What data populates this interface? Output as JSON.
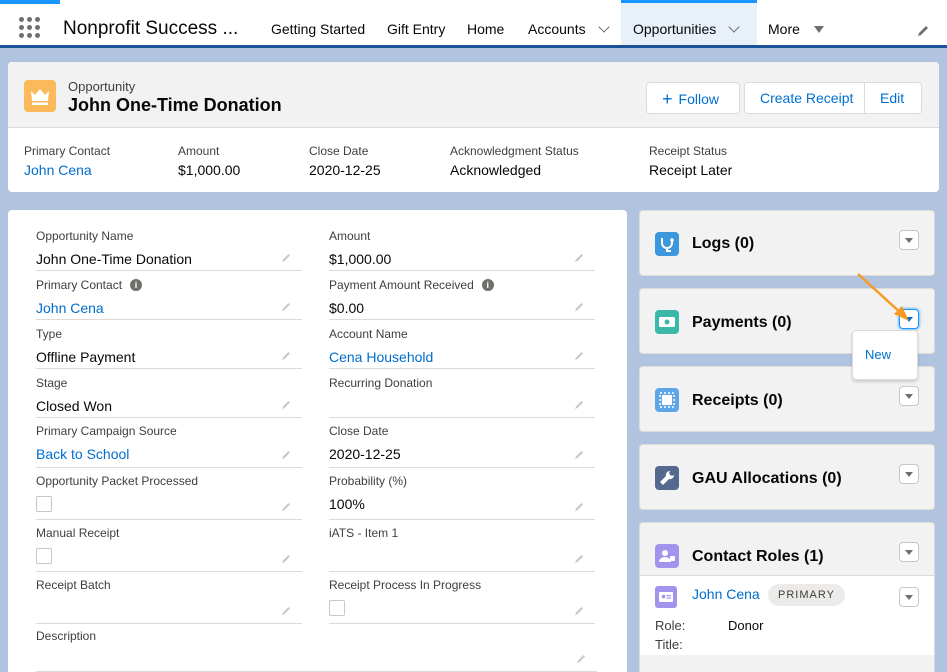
{
  "nav": {
    "app_name": "Nonprofit Success ...",
    "tabs": [
      {
        "label": "Getting Started"
      },
      {
        "label": "Gift Entry"
      },
      {
        "label": "Home"
      },
      {
        "label": "Accounts"
      },
      {
        "label": "Opportunities"
      },
      {
        "label": "More"
      }
    ]
  },
  "header": {
    "object_label": "Opportunity",
    "record_name": "John One-Time Donation",
    "buttons": {
      "follow": "Follow",
      "create_receipt": "Create Receipt",
      "edit": "Edit"
    },
    "fields": [
      {
        "label": "Primary Contact",
        "value": "John Cena"
      },
      {
        "label": "Amount",
        "value": "$1,000.00"
      },
      {
        "label": "Close Date",
        "value": "2020-12-25"
      },
      {
        "label": "Acknowledgment Status",
        "value": "Acknowledged"
      },
      {
        "label": "Receipt Status",
        "value": "Receipt Later"
      }
    ]
  },
  "details": {
    "left": [
      {
        "label": "Opportunity Name",
        "value": "John One-Time Donation"
      },
      {
        "label": "Primary Contact",
        "value": "John Cena"
      },
      {
        "label": "Type",
        "value": "Offline Payment"
      },
      {
        "label": "Stage",
        "value": "Closed Won"
      },
      {
        "label": "Primary Campaign Source",
        "value": "Back to School"
      },
      {
        "label": "Opportunity Packet Processed",
        "value": ""
      },
      {
        "label": "Manual Receipt",
        "value": ""
      },
      {
        "label": "Receipt Batch",
        "value": ""
      },
      {
        "label": "Description",
        "value": ""
      }
    ],
    "right": [
      {
        "label": "Amount",
        "value": "$1,000.00"
      },
      {
        "label": "Payment Amount Received",
        "value": "$0.00"
      },
      {
        "label": "Account Name",
        "value": "Cena Household"
      },
      {
        "label": "Recurring Donation",
        "value": ""
      },
      {
        "label": "Close Date",
        "value": "2020-12-25"
      },
      {
        "label": "Probability (%)",
        "value": "100%"
      },
      {
        "label": "iATS - Item 1",
        "value": ""
      },
      {
        "label": "Receipt Process In Progress",
        "value": ""
      }
    ],
    "info_glyph": "i"
  },
  "related": {
    "logs": "Logs (0)",
    "payments": "Payments (0)",
    "receipts": "Receipts (0)",
    "gau": "GAU Allocations (0)",
    "contact_roles": "Contact Roles (1)",
    "menu_new": "New",
    "contact": {
      "name": "John Cena",
      "badge": "PRIMARY",
      "role_label": "Role:",
      "role_value": "Donor",
      "title_label": "Title:"
    }
  },
  "icons": {
    "follow_icon": "+"
  },
  "colors": {
    "brand_blue": "#0070d2",
    "opportunity_icon": "#fcb95b",
    "logs_icon": "#3c97dd",
    "payments_icon": "#3bb8a7",
    "receipts_icon": "#5ea6e8",
    "gau_icon": "#54698d",
    "contact_roles_icon": "#a094ed",
    "annotation_arrow": "#f59a23"
  }
}
